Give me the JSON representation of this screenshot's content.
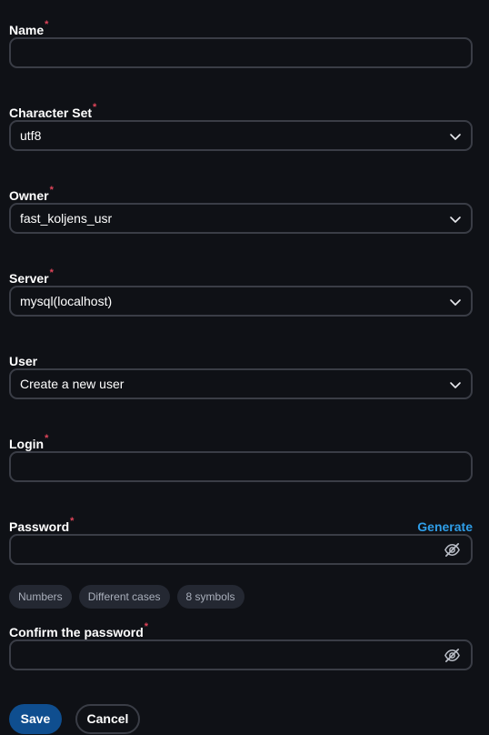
{
  "required_marker": "*",
  "fields": {
    "name": {
      "label": "Name",
      "value": ""
    },
    "charset": {
      "label": "Character Set",
      "value": "utf8"
    },
    "owner": {
      "label": "Owner",
      "value": "fast_koljens_usr"
    },
    "server": {
      "label": "Server",
      "value": "mysql(localhost)"
    },
    "user": {
      "label": "User",
      "value": "Create a new user"
    },
    "login": {
      "label": "Login",
      "value": ""
    },
    "password": {
      "label": "Password",
      "value": "",
      "generate_label": "Generate"
    },
    "confirm_password": {
      "label": "Confirm the password",
      "value": ""
    }
  },
  "password_hints": [
    "Numbers",
    "Different cases",
    "8 symbols"
  ],
  "actions": {
    "save_label": "Save",
    "cancel_label": "Cancel"
  },
  "icons": {
    "select": "chevron-down-icon",
    "visibility": "eye-off-icon"
  },
  "colors": {
    "accent": "#2f9ee8",
    "primary_button": "#0f4e8f",
    "required": "#e0455a",
    "background": "#0f1116"
  }
}
